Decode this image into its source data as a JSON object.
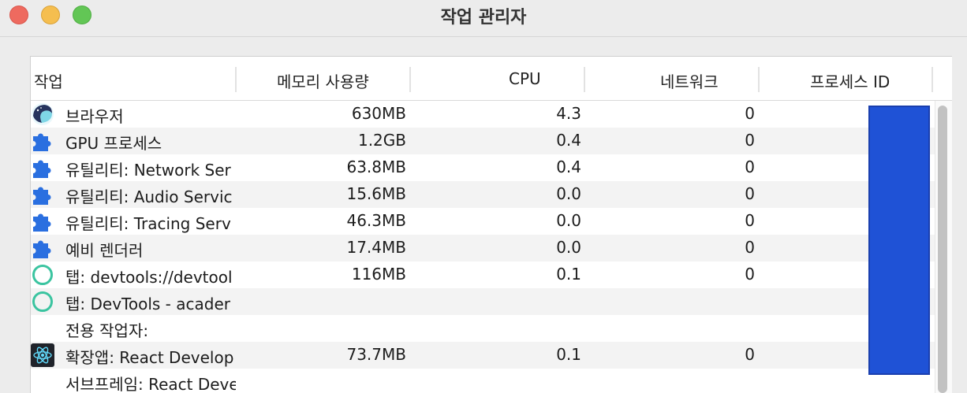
{
  "window": {
    "title": "작업 관리자"
  },
  "columns": [
    {
      "label": "작업"
    },
    {
      "label": "메모리 사용량"
    },
    {
      "label": "CPU"
    },
    {
      "label": "네트워크"
    },
    {
      "label": "프로세스 ID"
    }
  ],
  "rows": [
    {
      "name": "브라우저",
      "memory": "630MB",
      "cpu": "4.3",
      "network": "0",
      "icon": "whale-browser-icon"
    },
    {
      "name": "GPU 프로세스",
      "memory": "1.2GB",
      "cpu": "0.4",
      "network": "0",
      "icon": "puzzle-icon"
    },
    {
      "name": "유틸리티: Network Ser",
      "memory": "63.8MB",
      "cpu": "0.4",
      "network": "0",
      "icon": "puzzle-icon"
    },
    {
      "name": "유틸리티: Audio Servic",
      "memory": "15.6MB",
      "cpu": "0.0",
      "network": "0",
      "icon": "puzzle-icon"
    },
    {
      "name": "유틸리티: Tracing Serv",
      "memory": "46.3MB",
      "cpu": "0.0",
      "network": "0",
      "icon": "puzzle-icon"
    },
    {
      "name": "예비 렌더러",
      "memory": "17.4MB",
      "cpu": "0.0",
      "network": "0",
      "icon": "puzzle-icon"
    },
    {
      "name": "탭: devtools://devtool",
      "memory": "116MB",
      "cpu": "0.1",
      "network": "0",
      "icon": "tab-circle-icon"
    },
    {
      "name": "탭: DevTools - acader",
      "memory": "",
      "cpu": "",
      "network": "",
      "icon": "tab-circle-icon"
    },
    {
      "name": "전용 작업자:",
      "memory": "",
      "cpu": "",
      "network": "",
      "icon": ""
    },
    {
      "name": "확장앱: React Develop",
      "memory": "73.7MB",
      "cpu": "0.1",
      "network": "0",
      "icon": "react-icon"
    },
    {
      "name": "서브프레임: React Deve",
      "memory": "",
      "cpu": "",
      "network": "",
      "icon": ""
    }
  ],
  "colors": {
    "selection_block": "#1f52d6",
    "alt_row": "#f3f3f3",
    "puzzle": "#2a6fe0",
    "tab_circle": "#3bc4a0"
  }
}
